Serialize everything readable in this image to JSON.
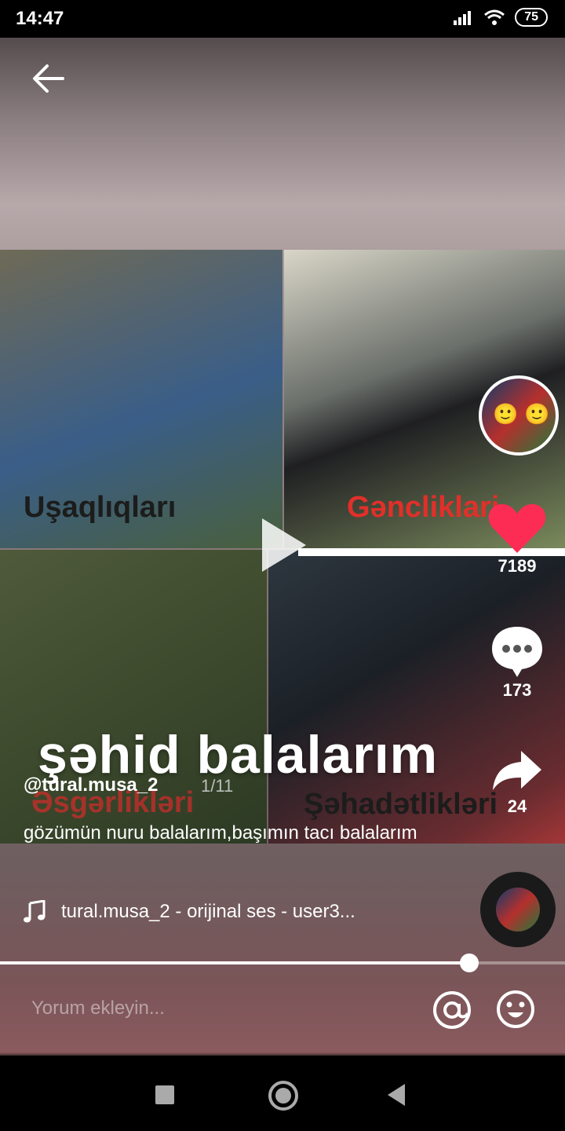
{
  "status": {
    "time": "14:47",
    "battery": "75"
  },
  "collage": {
    "labels": [
      "Uşaqlıqları",
      "Gəncliklari",
      "Əsgərlikləri",
      "Şəhadətlikləri"
    ],
    "overlay_title": "şəhid balalarım"
  },
  "post": {
    "username": "@tural.musa_2",
    "slide_indicator": "1/11",
    "caption": "gözümün nuru balalarım,başımın tacı balalarım",
    "music": "tural.musa_2 - orijinal ses - user3..."
  },
  "actions": {
    "likes": "7189",
    "comments": "173",
    "shares": "24"
  },
  "progress": {
    "fraction": 0.83
  },
  "comment": {
    "placeholder": "Yorum ekleyin..."
  },
  "colors": {
    "like": "#fd2c55",
    "accent": "#ffffff"
  },
  "icons": [
    "back-arrow-icon",
    "heart-icon",
    "comment-icon",
    "share-icon",
    "music-note-icon",
    "at-icon",
    "emoji-icon"
  ]
}
